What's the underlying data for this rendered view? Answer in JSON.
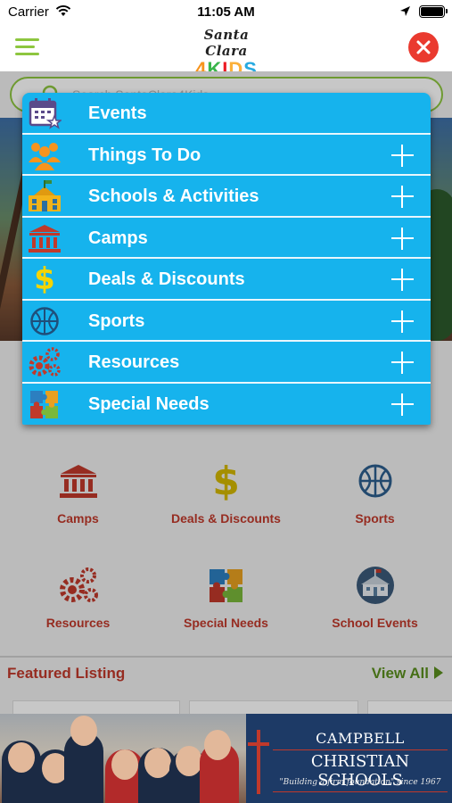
{
  "status_bar": {
    "carrier": "Carrier",
    "time": "11:05 AM"
  },
  "header": {
    "logo_line1": "Santa Clara",
    "logo_line2": [
      "4",
      "K",
      "I",
      "D",
      "S"
    ]
  },
  "search": {
    "placeholder": "Search SantaClara4Kids"
  },
  "menu": {
    "items": [
      {
        "label": "Events",
        "icon": "calendar-icon",
        "expandable": false
      },
      {
        "label": "Things To Do",
        "icon": "people-icon",
        "expandable": true
      },
      {
        "label": "Schools & Activities",
        "icon": "school-icon",
        "expandable": true
      },
      {
        "label": "Camps",
        "icon": "building-columns-icon",
        "expandable": true
      },
      {
        "label": "Deals & Discounts",
        "icon": "dollar-icon",
        "expandable": true
      },
      {
        "label": "Sports",
        "icon": "basketball-icon",
        "expandable": true
      },
      {
        "label": "Resources",
        "icon": "gears-icon",
        "expandable": true
      },
      {
        "label": "Special Needs",
        "icon": "puzzle-icon",
        "expandable": true
      }
    ]
  },
  "categories": [
    {
      "label": "Camps",
      "icon": "building-columns-icon"
    },
    {
      "label": "Deals & Discounts",
      "icon": "dollar-icon"
    },
    {
      "label": "Sports",
      "icon": "basketball-icon"
    },
    {
      "label": "Resources",
      "icon": "gears-icon"
    },
    {
      "label": "Special Needs",
      "icon": "puzzle-icon"
    },
    {
      "label": "School Events",
      "icon": "school-building-icon"
    }
  ],
  "featured": {
    "title": "Featured Listing",
    "view_all": "View All"
  },
  "ad": {
    "line1": "CAMPBELL",
    "line2": "CHRISTIAN SCHOOLS",
    "tagline": "\"Building a firm foundation\" since 1967"
  },
  "colors": {
    "menu_bg": "#16b3ed",
    "accent_green": "#8dc63f",
    "close_red": "#ea3a2f",
    "category_red": "#c0392b",
    "view_all_green": "#5a8f1e",
    "ad_navy": "#1d3a66"
  }
}
